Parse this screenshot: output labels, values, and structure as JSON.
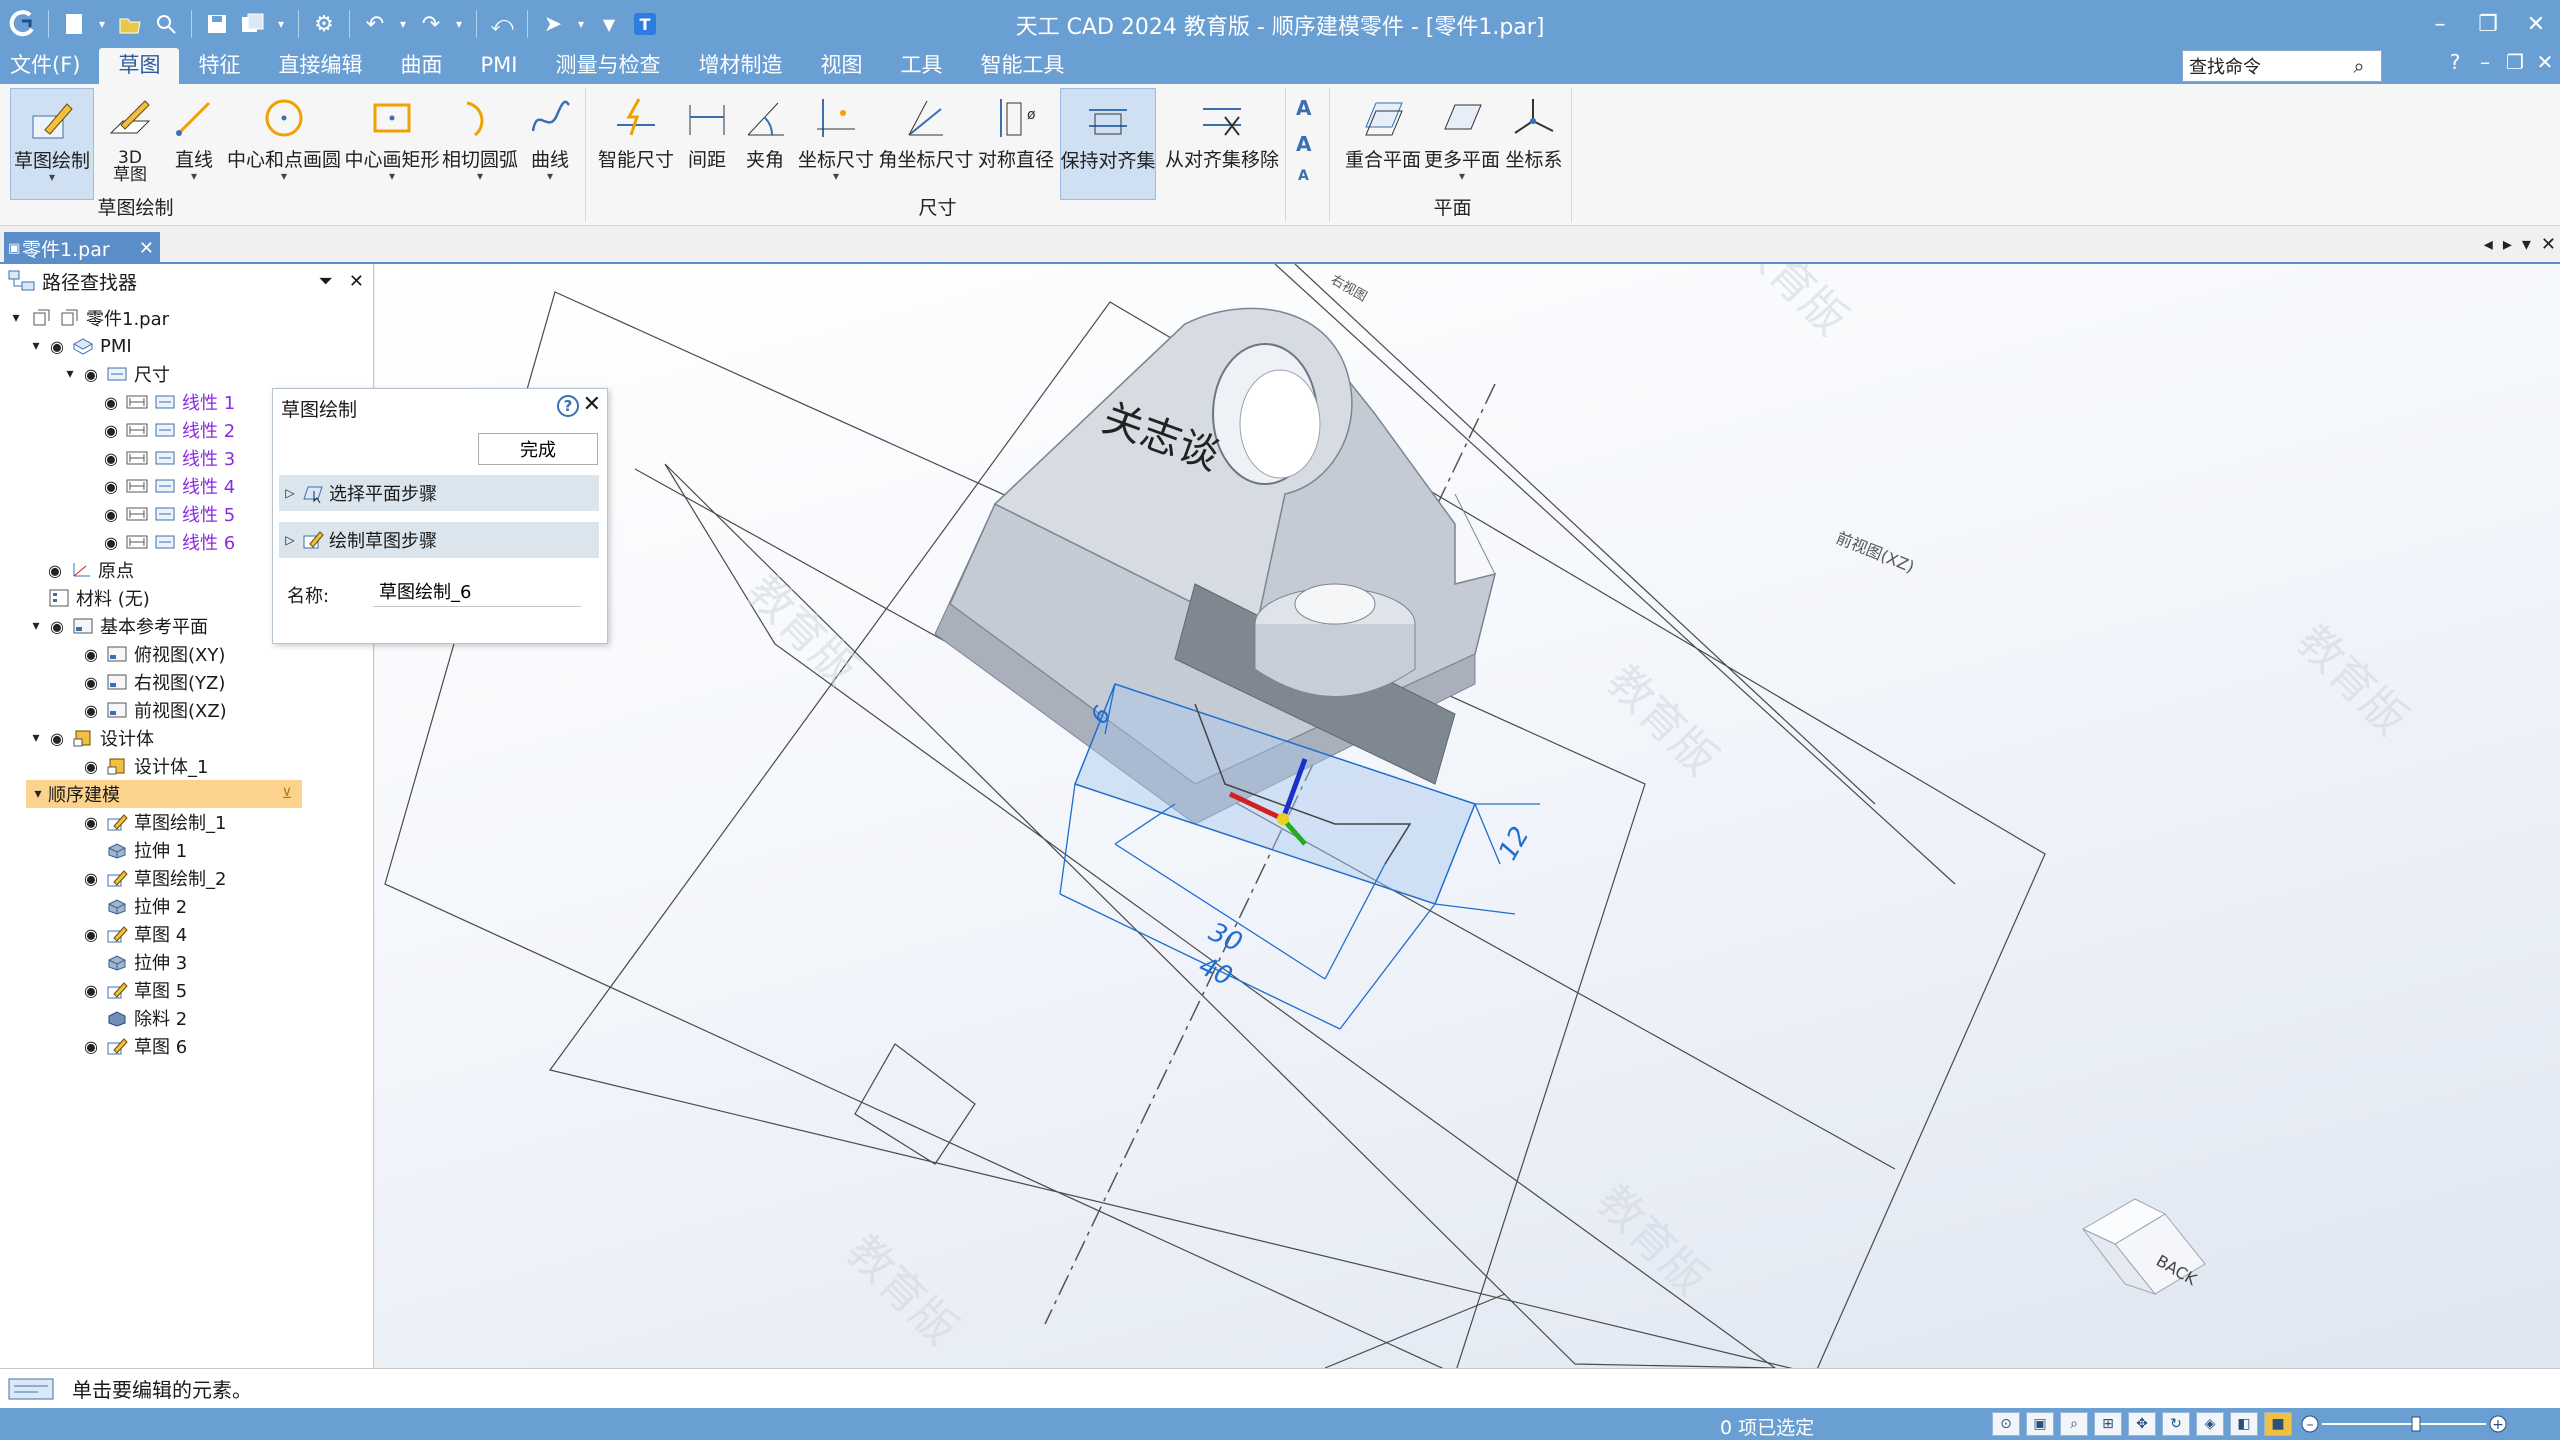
{
  "app_title": "天工 CAD 2024 教育版 - 顺序建模零件 - [零件1.par]",
  "menu": [
    "文件(F)",
    "草图",
    "特征",
    "直接编辑",
    "曲面",
    "PMI",
    "测量与检查",
    "增材制造",
    "视图",
    "工具",
    "智能工具"
  ],
  "search": {
    "placeholder": "查找命令",
    "value": "查找命令"
  },
  "ribbon": {
    "sketch_group": {
      "label": "草图绘制",
      "buttons": [
        "草图绘制",
        "3D\n草图",
        "直线",
        "中心和点画圆",
        "中心画矩形",
        "相切圆弧",
        "曲线"
      ]
    },
    "dim_group": {
      "label": "尺寸",
      "buttons": [
        "智能尺寸",
        "间距",
        "夹角",
        "坐标尺寸",
        "角坐标尺寸",
        "对称直径",
        "保持对齐集",
        "从对齐集移除"
      ]
    },
    "plane_group": {
      "label": "平面",
      "buttons": [
        "重合平面",
        "更多平面",
        "坐标系"
      ]
    }
  },
  "doc_tab": "零件1.par",
  "pathfinder": {
    "title": "路径查找器",
    "tree": [
      "零件1.par",
      "PMI",
      "尺寸",
      "线性 1",
      "线性 2",
      "线性 3",
      "线性 4",
      "线性 5",
      "线性 6",
      "原点",
      "材料 (无)",
      "基本参考平面",
      "俯视图(XY)",
      "右视图(YZ)",
      "前视图(XZ)",
      "设计体",
      "设计体_1",
      "顺序建模",
      "草图绘制_1",
      "拉伸 1",
      "草图绘制_2",
      "拉伸 2",
      "草图 4",
      "拉伸 3",
      "草图 5",
      "除料 2",
      "草图 6"
    ]
  },
  "sketch_panel": {
    "title": "草图绘制",
    "done": "完成",
    "step1": "选择平面步骤",
    "step2": "绘制草图步骤",
    "name_label": "名称:",
    "name_value": "草图绘制_6"
  },
  "viewport": {
    "model_text": "关志谈",
    "plane_label_1": "前视图(XZ)",
    "plane_label_2": "右视图",
    "dims": [
      "30",
      "40",
      "12",
      "6"
    ],
    "watermark": "教育版",
    "viewcube": "BACK"
  },
  "prompt": "单击要编辑的元素。",
  "status": "0 项已选定",
  "colors": {
    "accent": "#6a9fd4",
    "dim_blue": "#1f6fd0",
    "tree_purple": "#8a2be2",
    "highlight": "#fbd38d"
  }
}
